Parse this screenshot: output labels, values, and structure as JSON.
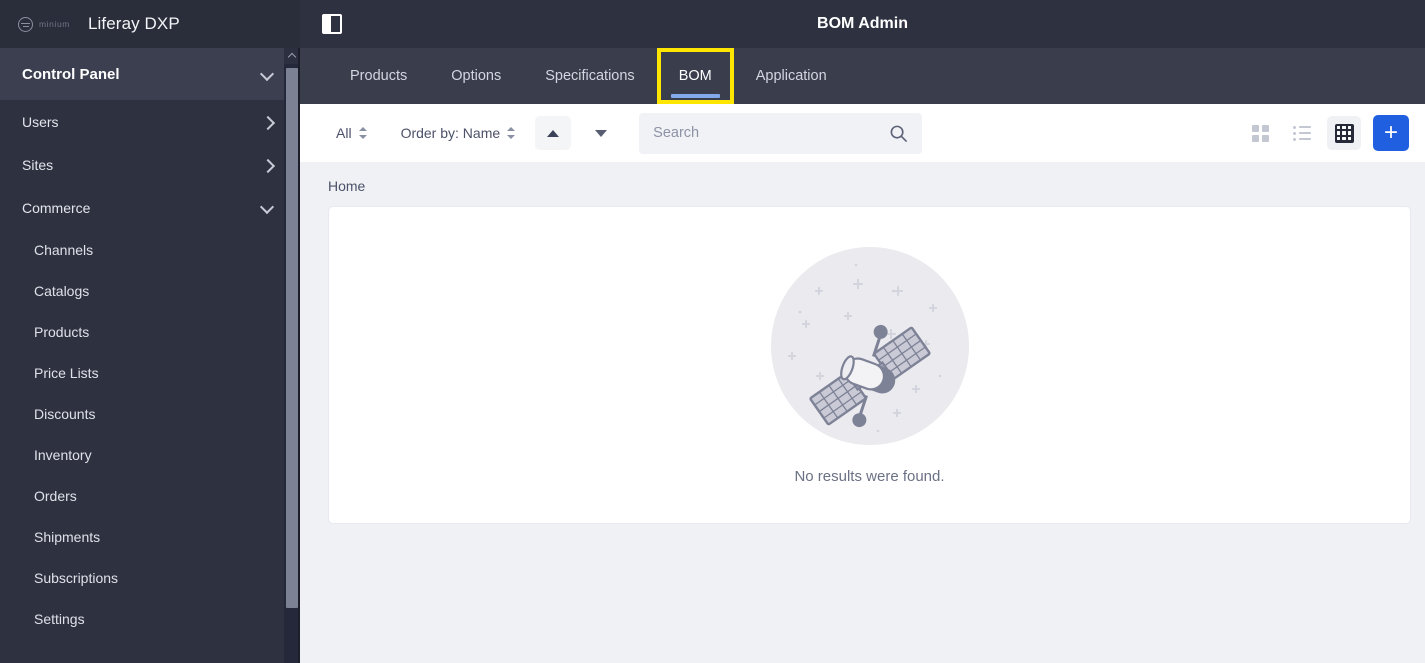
{
  "sidebar": {
    "brand": {
      "logo_icon": "minium-circle-icon",
      "logo_word": "minium",
      "title": "Liferay DXP"
    },
    "group_header": {
      "label": "Control Panel",
      "icon": "chevron-down-icon"
    },
    "items": [
      {
        "label": "Users",
        "icon": "chevron-right-icon",
        "type": "group"
      },
      {
        "label": "Sites",
        "icon": "chevron-right-icon",
        "type": "group"
      },
      {
        "label": "Commerce",
        "icon": "chevron-down-icon",
        "type": "group"
      }
    ],
    "sub_items": [
      {
        "label": "Channels"
      },
      {
        "label": "Catalogs"
      },
      {
        "label": "Products"
      },
      {
        "label": "Price Lists"
      },
      {
        "label": "Discounts"
      },
      {
        "label": "Inventory"
      },
      {
        "label": "Orders"
      },
      {
        "label": "Shipments"
      },
      {
        "label": "Subscriptions"
      },
      {
        "label": "Settings"
      }
    ],
    "scrollbar": {
      "up_arrow_icon": "chevron-up-icon"
    }
  },
  "topbar": {
    "panel_toggle_icon": "sidebar-toggle-icon",
    "title": "BOM Admin"
  },
  "tabs": [
    {
      "label": "Products",
      "active": false
    },
    {
      "label": "Options",
      "active": false
    },
    {
      "label": "Specifications",
      "active": false
    },
    {
      "label": "BOM",
      "active": true
    },
    {
      "label": "Application",
      "active": false
    }
  ],
  "toolbar": {
    "filter_label": "All",
    "filter_caret_icon": "caret-updown-icon",
    "order_label": "Order by: Name",
    "order_caret_icon": "caret-updown-icon",
    "sort_asc_icon": "triangle-up-icon",
    "sort_desc_icon": "triangle-down-icon",
    "search": {
      "value": "",
      "placeholder": "Search",
      "icon": "search-icon"
    },
    "views": [
      {
        "name": "card-view",
        "icon": "cards-grid-icon",
        "active": false
      },
      {
        "name": "list-view",
        "icon": "bullet-list-icon",
        "active": false
      },
      {
        "name": "table-view",
        "icon": "table-grid-icon",
        "active": true
      }
    ],
    "add_button": {
      "label": "+",
      "icon": "plus-icon",
      "color": "#1f5fe0"
    }
  },
  "breadcrumb": {
    "label": "Home"
  },
  "content": {
    "empty_state": {
      "illustration": "satellite-in-space-icon",
      "message": "No results were found."
    }
  },
  "colors": {
    "sidebar_bg": "#2e3240",
    "topbar_bg": "#2e3240",
    "tabbar_bg": "#393d4c",
    "page_bg": "#f0f1f5",
    "highlight_yellow": "#ffe600",
    "tab_underline_blue": "#81a9ec",
    "accent_blue": "#1f5fe0"
  }
}
